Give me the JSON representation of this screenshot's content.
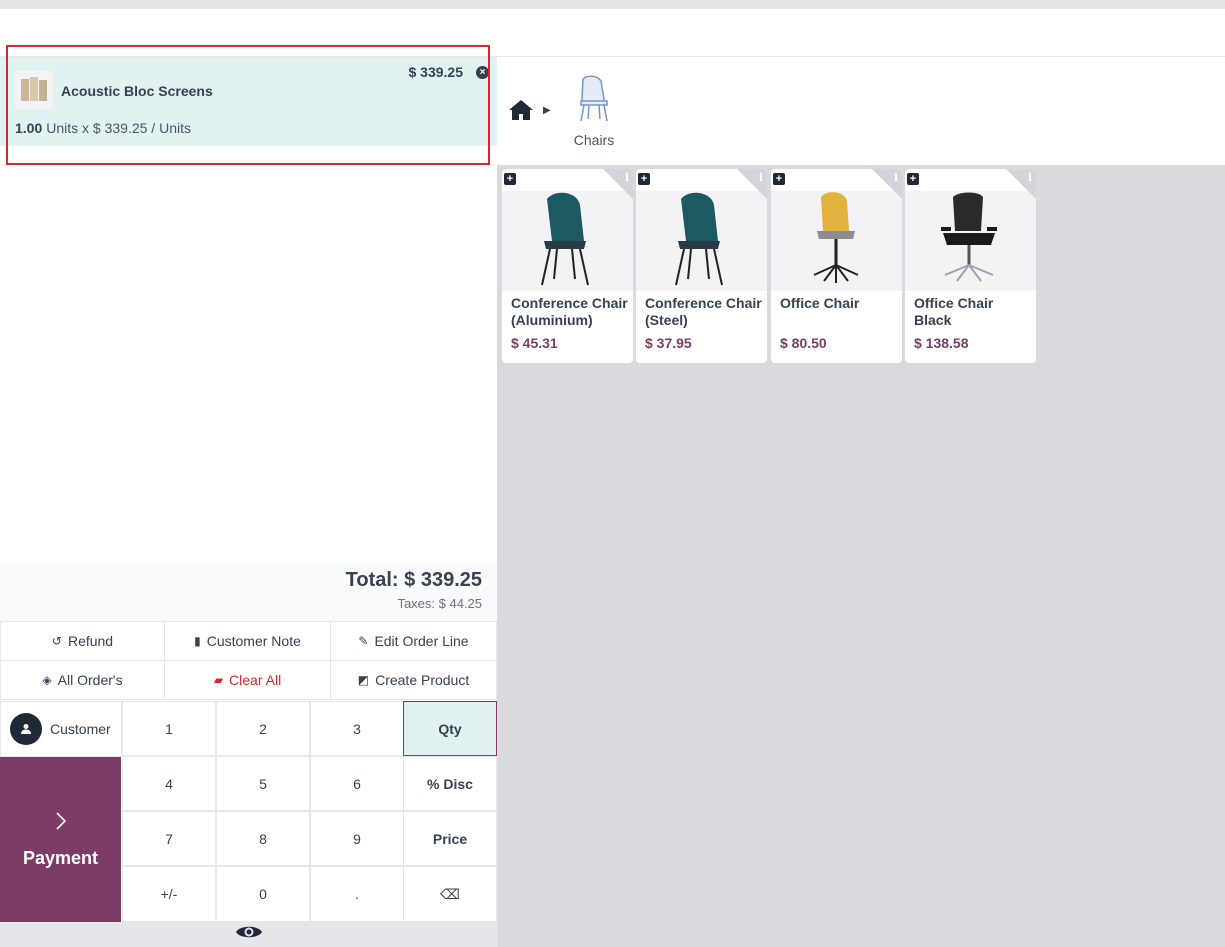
{
  "order": {
    "line": {
      "name": "Acoustic Bloc Screens",
      "price": "$ 339.25",
      "quantity": "1.00",
      "unit_detail": "Units x $ 339.25 / Units"
    },
    "total": "Total: $ 339.25",
    "taxes": "Taxes: $ 44.25"
  },
  "actions": {
    "refund": "Refund",
    "customer_note": "Customer Note",
    "edit_order_line": "Edit Order Line",
    "all_orders": "All Order's",
    "clear_all": "Clear All",
    "create_product": "Create Product"
  },
  "numpad": {
    "customer": "Customer",
    "payment": "Payment",
    "k1": "1",
    "k2": "2",
    "k3": "3",
    "k4": "4",
    "k5": "5",
    "k6": "6",
    "k7": "7",
    "k8": "8",
    "k9": "9",
    "plusminus": "+/-",
    "k0": "0",
    "dot": ".",
    "qty": "Qty",
    "disc": "% Disc",
    "price": "Price",
    "backspace": "⌫"
  },
  "category": {
    "name": "Chairs"
  },
  "products": [
    {
      "name": "Conference Chair (Aluminium)",
      "price": "$ 45.31"
    },
    {
      "name": "Conference Chair (Steel)",
      "price": "$ 37.95"
    },
    {
      "name": "Office Chair",
      "price": "$ 80.50"
    },
    {
      "name": "Office Chair Black",
      "price": "$ 138.58"
    }
  ],
  "colors": {
    "brand": "#7d3c65",
    "selected_line": "#e0f2f1",
    "highlight": "#d9262f"
  }
}
